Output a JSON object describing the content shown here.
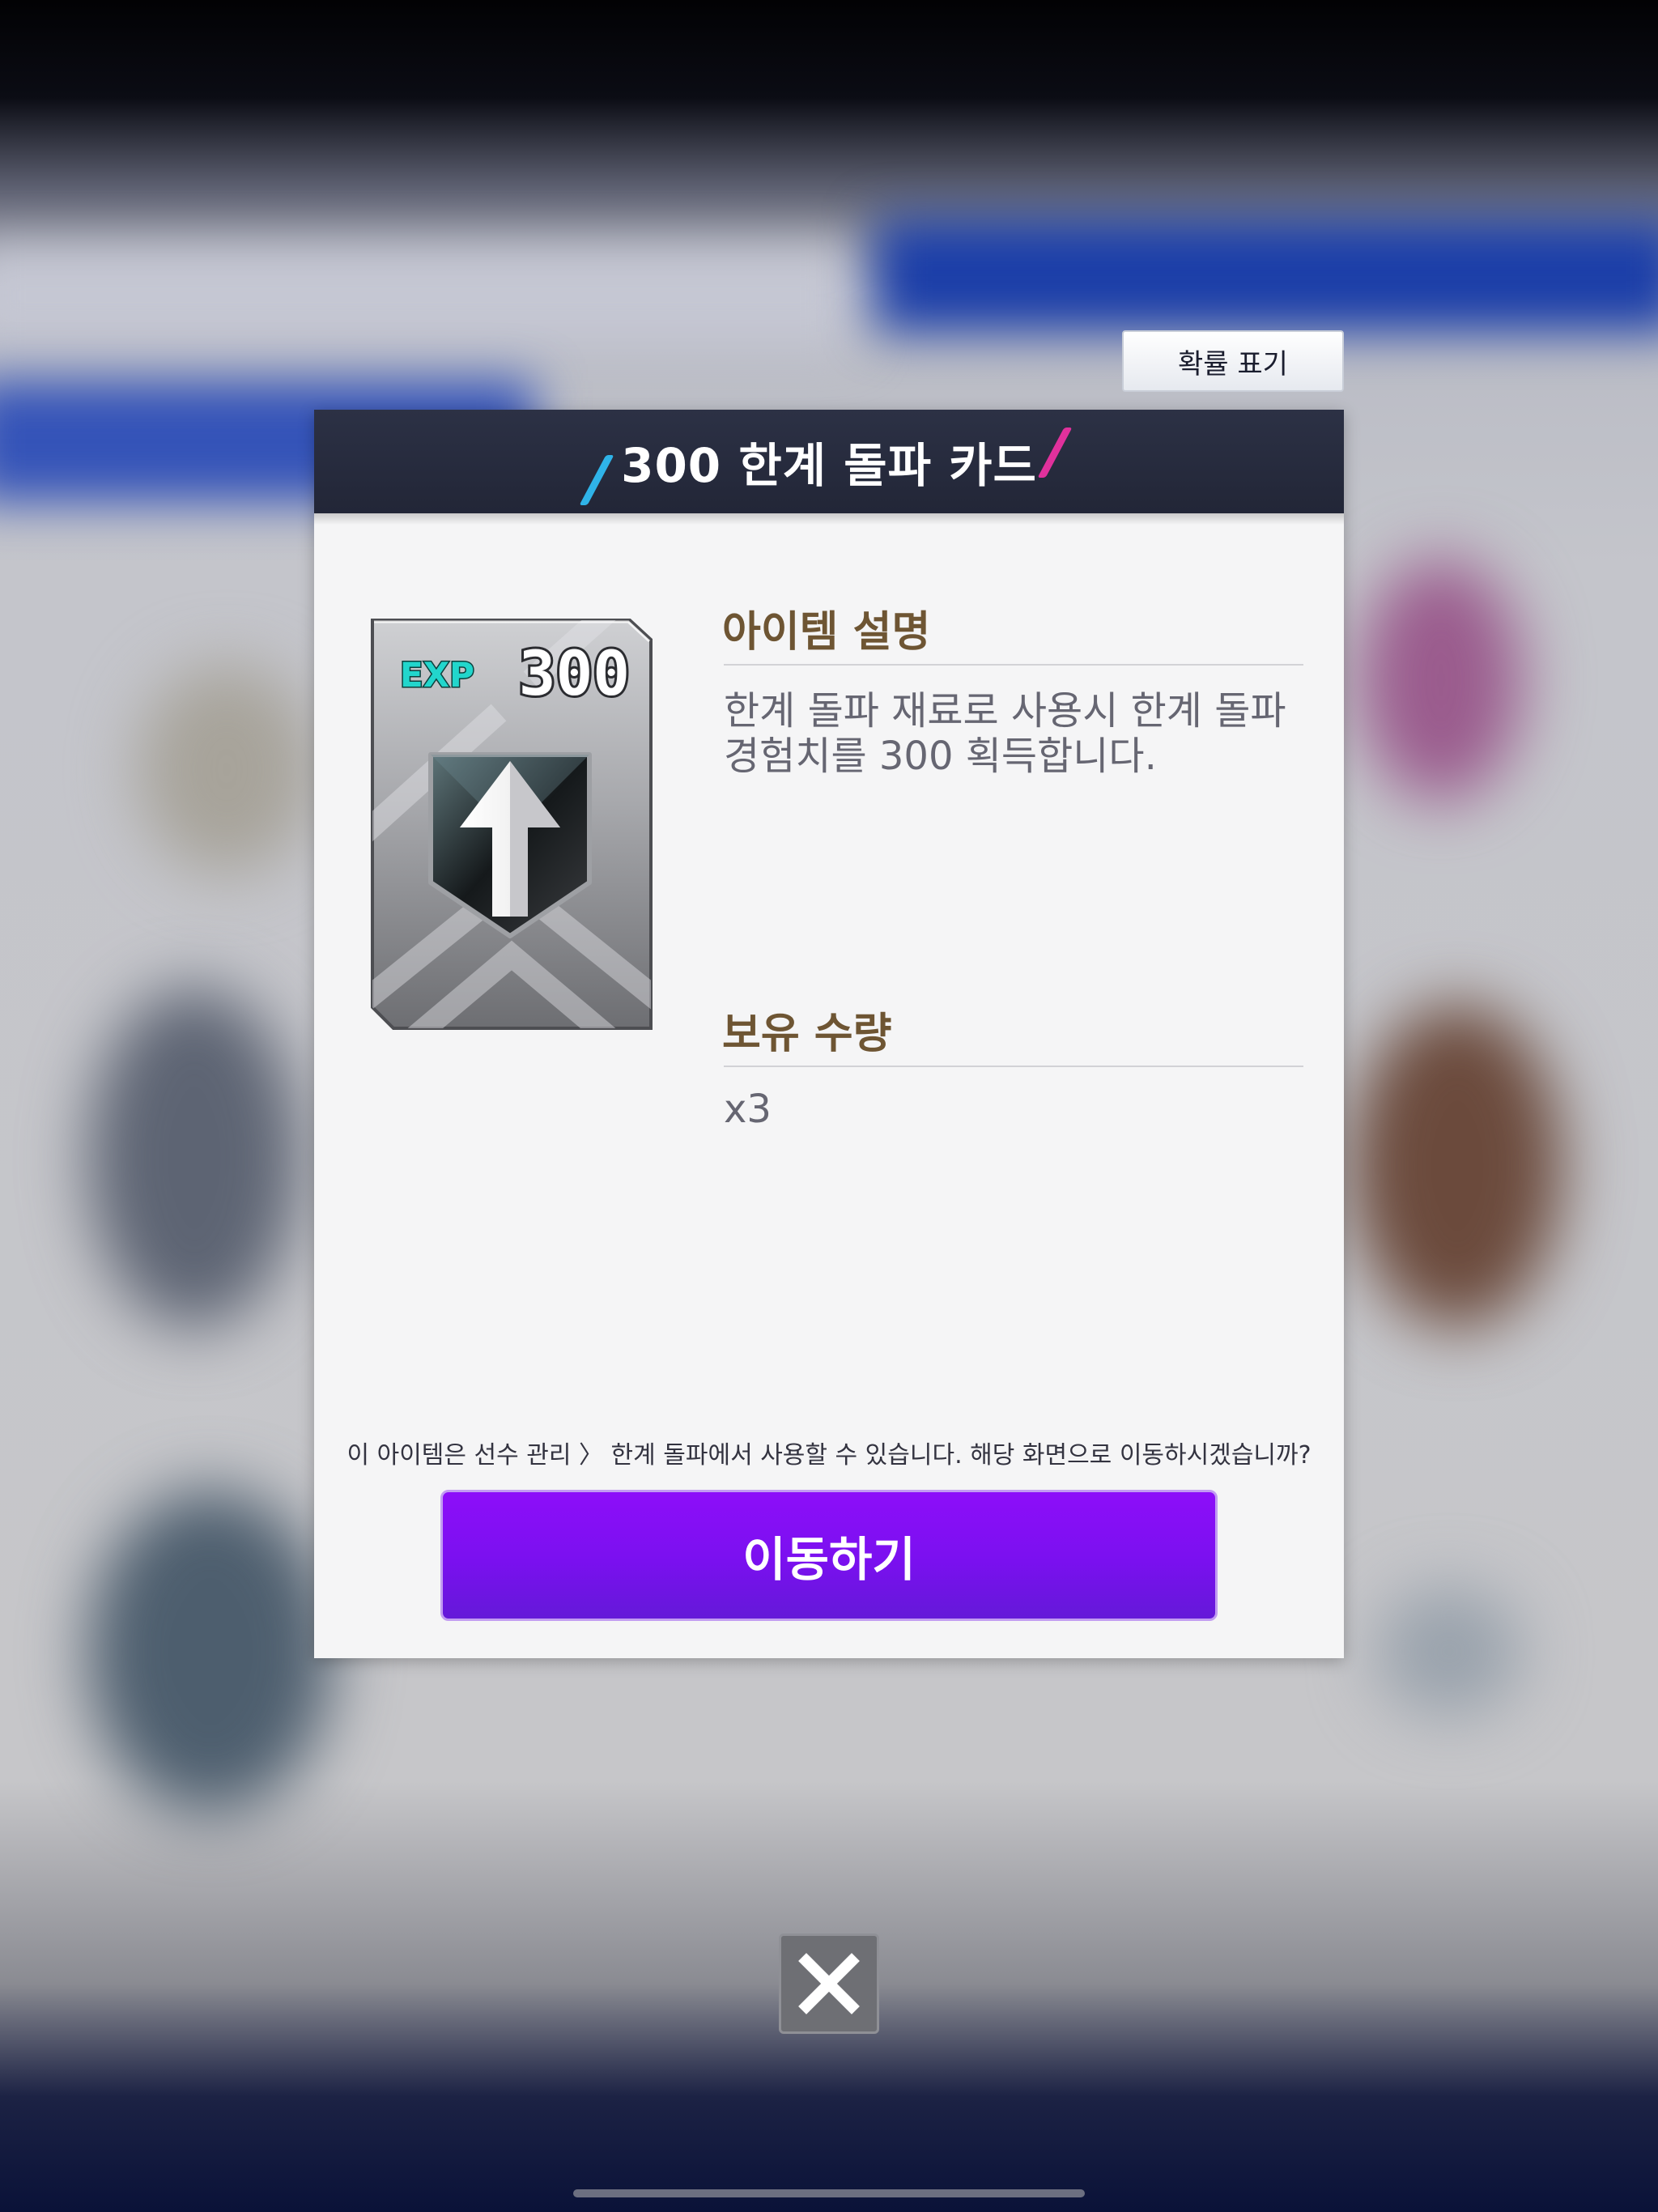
{
  "probability_button": {
    "label": "확률 표기"
  },
  "modal": {
    "title": "300 한계 돌파 카드",
    "item_card": {
      "exp_badge": "EXP",
      "value": "300",
      "icon": "arrow-up-icon"
    },
    "description": {
      "heading": "아이템 설명",
      "line1": "한계 돌파 재료로 사용시 한계 돌파",
      "line2": "경험치를 300 획득합니다."
    },
    "quantity": {
      "heading": "보유 수량",
      "value": "x3"
    },
    "notice": "이 아이템은 선수 관리 〉 한계 돌파에서 사용할 수 있습니다. 해당 화면으로 이동하시겠습니까?",
    "go_button": {
      "label": "이동하기"
    }
  },
  "close_button": {
    "icon": "close-icon"
  },
  "colors": {
    "header": "#2c3145",
    "accent_blue": "#2fb3e8",
    "accent_pink": "#e0319c",
    "button_purple": "#7a10ef",
    "heading_brown": "#6e5533"
  }
}
